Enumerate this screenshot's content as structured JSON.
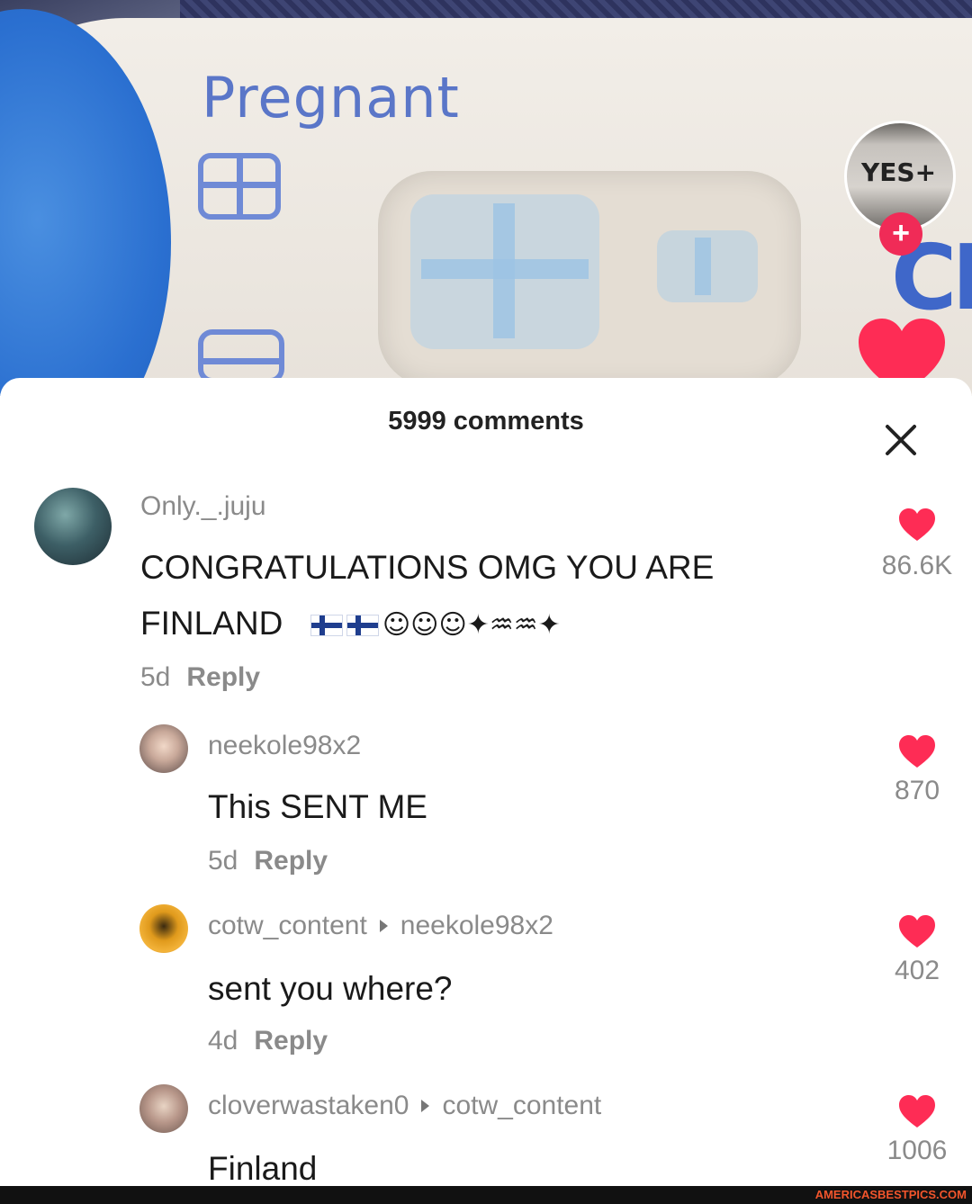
{
  "video": {
    "test_label": "Pregnant",
    "avatar_badge": "YES+",
    "follow_button": "+",
    "partial_text": "CI"
  },
  "comments_panel": {
    "title": "5999 comments",
    "close_icon": "close-icon"
  },
  "comments": [
    {
      "username": "Only._.juju",
      "text_line1": "CONGRATULATIONS OMG YOU ARE",
      "text_line2": "FINLAND",
      "emojis": [
        "flag-finland",
        "flag-finland",
        "partying-face",
        "partying-face",
        "partying-face",
        "party-popper",
        "jellyfish",
        "jellyfish",
        "party-popper"
      ],
      "age": "5d",
      "reply": "Reply",
      "likes": "86.6K"
    },
    {
      "username": "neekole98x2",
      "text": "This SENT ME",
      "age": "5d",
      "reply": "Reply",
      "likes": "870"
    },
    {
      "username": "cotw_content",
      "reply_to": "neekole98x2",
      "text": "sent you where?",
      "age": "4d",
      "reply": "Reply",
      "likes": "402"
    },
    {
      "username": "cloverwastaken0",
      "reply_to": "cotw_content",
      "text": "Finland",
      "likes": "1006"
    }
  ],
  "watermark": "AMERICASBESTPICS.COM",
  "colors": {
    "like_red": "#fe2c55",
    "follow_pink": "#f02b57",
    "text_gray": "#8a8a8a"
  }
}
